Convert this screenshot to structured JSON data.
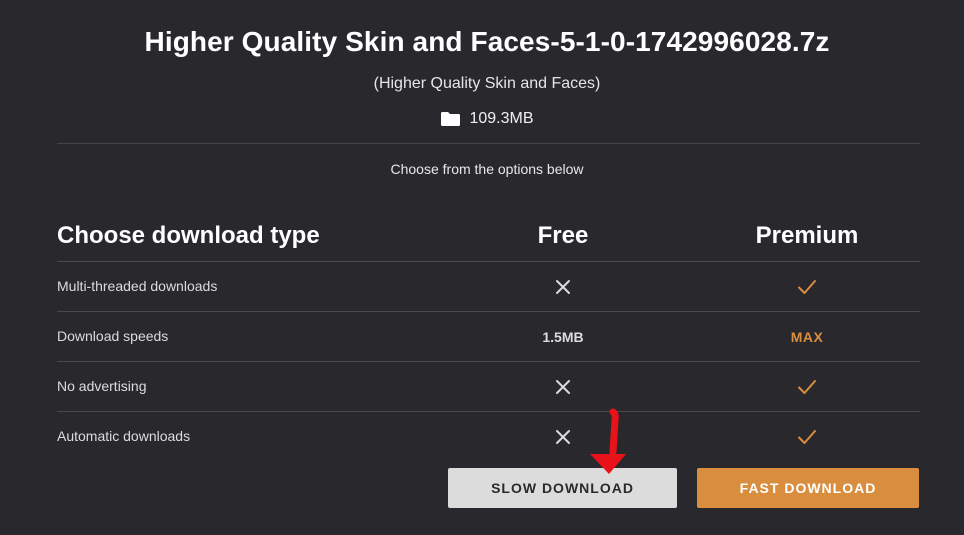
{
  "header": {
    "title": "Higher Quality Skin and Faces-5-1-0-1742996028.7z",
    "subtitle": "(Higher Quality Skin and Faces)",
    "file_size": "109.3MB",
    "folder_icon": "folder-icon",
    "choose_text": "Choose from the options below"
  },
  "table": {
    "heading": "Choose download type",
    "col_free": "Free",
    "col_premium": "Premium",
    "rows": [
      {
        "label": "Multi-threaded downloads",
        "free_icon": "x-icon",
        "premium_icon": "check-icon"
      },
      {
        "label": "Download speeds",
        "free_text": "1.5MB",
        "premium_text": "MAX"
      },
      {
        "label": "No advertising",
        "free_icon": "x-icon",
        "premium_icon": "check-icon"
      },
      {
        "label": "Automatic downloads",
        "free_icon": "x-icon",
        "premium_icon": "check-icon"
      }
    ]
  },
  "buttons": {
    "slow_label": "SLOW DOWNLOAD",
    "fast_label": "FAST DOWNLOAD"
  },
  "annotation": {
    "icon": "red-arrow-icon"
  },
  "colors": {
    "background": "#29282d",
    "accent": "#d98e3f",
    "annotation": "#e8121b",
    "slow_button_bg": "#dcdcdc"
  }
}
